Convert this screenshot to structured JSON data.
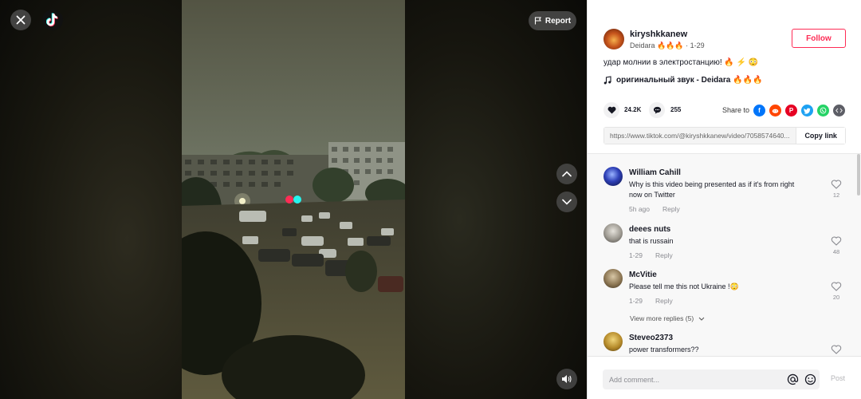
{
  "player": {
    "report_label": "Report"
  },
  "author": {
    "username": "kiryshkkanew",
    "nickname_line": "Deidara 🔥🔥🔥 · 1-29",
    "follow_label": "Follow"
  },
  "video": {
    "description": "удар молнии в электростанцию! 🔥 ⚡ 😳",
    "music": "оригинальный звук - Deidara 🔥🔥🔥"
  },
  "stats": {
    "likes": "24.2K",
    "comments": "255",
    "share_label": "Share to"
  },
  "share_link": {
    "url": "https://www.tiktok.com/@kiryshkkanew/video/7058574640...",
    "copy_label": "Copy link"
  },
  "comments": [
    {
      "user": "William Cahill",
      "text": "Why is this video being presented as if it's from right now on Twitter",
      "time": "5h ago",
      "reply_label": "Reply",
      "likes": "12"
    },
    {
      "user": "deees nuts",
      "text": "that is russain",
      "time": "1-29",
      "reply_label": "Reply",
      "likes": "48"
    },
    {
      "user": "McVitie",
      "text": "Please tell me this not Ukraine !😳",
      "time": "1-29",
      "reply_label": "Reply",
      "likes": "20",
      "more_replies": "View more replies (5)"
    },
    {
      "user": "Steveo2373",
      "text": "power transformers??"
    }
  ],
  "composer": {
    "placeholder": "Add comment...",
    "post_label": "Post"
  },
  "colors": {
    "accent": "#fe2c55",
    "loader_left": "#fe2c55",
    "loader_right": "#25f4ee"
  }
}
